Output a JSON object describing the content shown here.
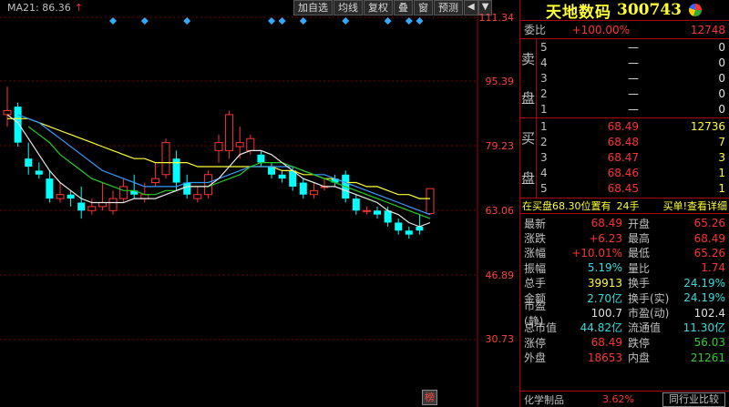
{
  "chart": {
    "ma_label": "MA21: 86.36",
    "ma_arrow": "↑",
    "toolbar": [
      "加自选",
      "均线",
      "复权",
      "叠",
      "窗",
      "预测"
    ],
    "toolbar_arrows": [
      "◀",
      "▼"
    ],
    "price_axis": [
      "111.34",
      "95.39",
      "79.23",
      "63.06",
      "46.89",
      "30.73"
    ],
    "badge": "榜",
    "colors": {
      "up": "#ff3333",
      "down": "#00ffff",
      "ma_white": "#e8e8e8",
      "ma_yellow": "#ffff33",
      "ma_green": "#22cc22",
      "ma_blue": "#3399ff"
    }
  },
  "chart_data": {
    "type": "candlestick",
    "ylim": [
      30.73,
      111.34
    ],
    "candles": [
      {
        "o": 87,
        "c": 88,
        "h": 94,
        "l": 84
      },
      {
        "o": 89,
        "c": 80,
        "h": 90,
        "l": 79
      },
      {
        "o": 76,
        "c": 74,
        "h": 80,
        "l": 72
      },
      {
        "o": 73,
        "c": 72,
        "h": 75,
        "l": 71
      },
      {
        "o": 71,
        "c": 66,
        "h": 73,
        "l": 65
      },
      {
        "o": 66,
        "c": 67,
        "h": 70,
        "l": 65
      },
      {
        "o": 67,
        "c": 66,
        "h": 68,
        "l": 64
      },
      {
        "o": 65,
        "c": 63,
        "h": 69,
        "l": 61
      },
      {
        "o": 63,
        "c": 64,
        "h": 66,
        "l": 62
      },
      {
        "o": 64,
        "c": 65,
        "h": 70,
        "l": 63
      },
      {
        "o": 63,
        "c": 66,
        "h": 68,
        "l": 62
      },
      {
        "o": 66,
        "c": 69,
        "h": 71,
        "l": 65
      },
      {
        "o": 68,
        "c": 67,
        "h": 72,
        "l": 66
      },
      {
        "o": 66,
        "c": 67,
        "h": 70,
        "l": 65
      },
      {
        "o": 70,
        "c": 71,
        "h": 75,
        "l": 69
      },
      {
        "o": 72,
        "c": 80,
        "h": 81,
        "l": 71
      },
      {
        "o": 76,
        "c": 70,
        "h": 78,
        "l": 68
      },
      {
        "o": 70,
        "c": 67,
        "h": 72,
        "l": 66
      },
      {
        "o": 66,
        "c": 67,
        "h": 69,
        "l": 65
      },
      {
        "o": 67,
        "c": 72,
        "h": 73,
        "l": 66
      },
      {
        "o": 78,
        "c": 80,
        "h": 82,
        "l": 75
      },
      {
        "o": 78,
        "c": 87,
        "h": 88,
        "l": 76
      },
      {
        "o": 79,
        "c": 80,
        "h": 84,
        "l": 76
      },
      {
        "o": 78,
        "c": 81,
        "h": 82,
        "l": 77
      },
      {
        "o": 77,
        "c": 75,
        "h": 78,
        "l": 74
      },
      {
        "o": 74,
        "c": 72,
        "h": 75,
        "l": 71
      },
      {
        "o": 72,
        "c": 71,
        "h": 73,
        "l": 70
      },
      {
        "o": 73,
        "c": 69,
        "h": 74,
        "l": 68
      },
      {
        "o": 70,
        "c": 67,
        "h": 71,
        "l": 66
      },
      {
        "o": 67,
        "c": 68,
        "h": 70,
        "l": 66
      },
      {
        "o": 69,
        "c": 69,
        "h": 71,
        "l": 68
      },
      {
        "o": 71,
        "c": 70,
        "h": 72,
        "l": 69
      },
      {
        "o": 72,
        "c": 66,
        "h": 73,
        "l": 65
      },
      {
        "o": 66,
        "c": 63,
        "h": 67,
        "l": 62
      },
      {
        "o": 63,
        "c": 63,
        "h": 64,
        "l": 62
      },
      {
        "o": 63,
        "c": 62,
        "h": 64,
        "l": 61
      },
      {
        "o": 63,
        "c": 60,
        "h": 64,
        "l": 59
      },
      {
        "o": 60,
        "c": 58,
        "h": 61,
        "l": 57
      },
      {
        "o": 58,
        "c": 57,
        "h": 59,
        "l": 56
      },
      {
        "o": 59,
        "c": 58,
        "h": 62,
        "l": 57
      },
      {
        "o": 62.26,
        "c": 68.49,
        "h": 68.49,
        "l": 62
      }
    ],
    "ma_white": [
      87,
      85,
      81,
      77,
      73,
      70,
      68,
      66,
      65,
      65,
      65,
      65,
      66,
      66,
      66,
      67,
      68,
      69,
      69,
      69,
      71,
      74,
      77,
      78,
      78,
      77,
      75,
      73,
      71,
      70,
      69,
      69,
      68,
      67,
      66,
      65,
      63,
      62,
      60,
      59,
      60
    ],
    "ma_green": [
      null,
      null,
      84,
      82,
      80,
      77,
      75,
      73,
      71,
      70,
      69,
      68,
      68,
      67,
      67,
      68,
      68,
      69,
      69,
      69,
      70,
      71,
      72,
      74,
      75,
      75,
      75,
      74,
      73,
      72,
      71,
      70,
      69,
      68,
      67,
      66,
      65,
      64,
      63,
      62,
      61
    ],
    "ma_blue": [
      null,
      87,
      86,
      85,
      83,
      81,
      79,
      77,
      75,
      73,
      72,
      71,
      70,
      69,
      69,
      69,
      69,
      70,
      70,
      70,
      71,
      72,
      73,
      74,
      74,
      74,
      74,
      74,
      73,
      72,
      72,
      71,
      70,
      69,
      68,
      67,
      66,
      65,
      64,
      63,
      62
    ],
    "ma_yellow": [
      86,
      86,
      86,
      85,
      84,
      83,
      82,
      81,
      80,
      79,
      78,
      77,
      76,
      76,
      75,
      75,
      75,
      75,
      74,
      74,
      74,
      74,
      74,
      74,
      74,
      74,
      73,
      73,
      72,
      72,
      71,
      71,
      70,
      70,
      69,
      69,
      68,
      67,
      67,
      66,
      66
    ],
    "event_markers": [
      10,
      13,
      17,
      25,
      26,
      28,
      32,
      36,
      38,
      39
    ]
  },
  "panel": {
    "stock_name": "天地数码",
    "stock_code": "300743",
    "weibi": {
      "label": "委比",
      "pct": "+100.00%",
      "value": "12748"
    },
    "sell_label": [
      "卖",
      "盘"
    ],
    "buy_label": [
      "买",
      "盘"
    ],
    "sells": [
      {
        "lvl": "5",
        "price": "—",
        "vol": "0"
      },
      {
        "lvl": "4",
        "price": "—",
        "vol": "0"
      },
      {
        "lvl": "3",
        "price": "—",
        "vol": "0"
      },
      {
        "lvl": "2",
        "price": "—",
        "vol": "0"
      },
      {
        "lvl": "1",
        "price": "—",
        "vol": "0"
      }
    ],
    "buys": [
      {
        "lvl": "1",
        "price": "68.49",
        "vol": "12736"
      },
      {
        "lvl": "2",
        "price": "68.48",
        "vol": "7"
      },
      {
        "lvl": "3",
        "price": "68.47",
        "vol": "3"
      },
      {
        "lvl": "4",
        "price": "68.46",
        "vol": "1"
      },
      {
        "lvl": "5",
        "price": "68.45",
        "vol": "1"
      }
    ],
    "status": {
      "text": "在买盘68.30位置有",
      "hands": "24手",
      "link": "买单!查看详细"
    },
    "quotes": [
      {
        "k": "最新",
        "v": "68.49",
        "vc": "red",
        "k2": "开盘",
        "v2": "65.26",
        "v2c": "red"
      },
      {
        "k": "涨跌",
        "v": "+6.23",
        "vc": "red",
        "k2": "最高",
        "v2": "68.49",
        "v2c": "red"
      },
      {
        "k": "涨幅",
        "v": "+10.01%",
        "vc": "red",
        "k2": "最低",
        "v2": "65.26",
        "v2c": "red"
      },
      {
        "k": "振幅",
        "v": "5.19%",
        "vc": "cyan",
        "k2": "量比",
        "v2": "1.74",
        "v2c": "red"
      },
      {
        "k": "总手",
        "v": "39913",
        "vc": "yellow",
        "k2": "换手",
        "v2": "24.19%",
        "v2c": "cyan"
      },
      {
        "k": "金额",
        "v": "2.70亿",
        "vc": "cyan",
        "k2": "换手(实)",
        "v2": "24.19%",
        "v2c": "cyan"
      },
      {
        "k": "市盈(静)",
        "v": "100.7",
        "vc": "white",
        "k2": "市盈(动)",
        "v2": "102.4",
        "v2c": "white"
      },
      {
        "k": "总市值",
        "v": "44.82亿",
        "vc": "cyan",
        "k2": "流通值",
        "v2": "11.30亿",
        "v2c": "cyan"
      },
      {
        "k": "涨停",
        "v": "68.49",
        "vc": "red",
        "k2": "跌停",
        "v2": "56.03",
        "v2c": "green"
      },
      {
        "k": "外盘",
        "v": "18653",
        "vc": "red",
        "k2": "内盘",
        "v2": "21261",
        "v2c": "green"
      }
    ],
    "footer": {
      "industry": "化学制品",
      "industry_pct": "3.62%",
      "compare": "同行业比较"
    }
  }
}
